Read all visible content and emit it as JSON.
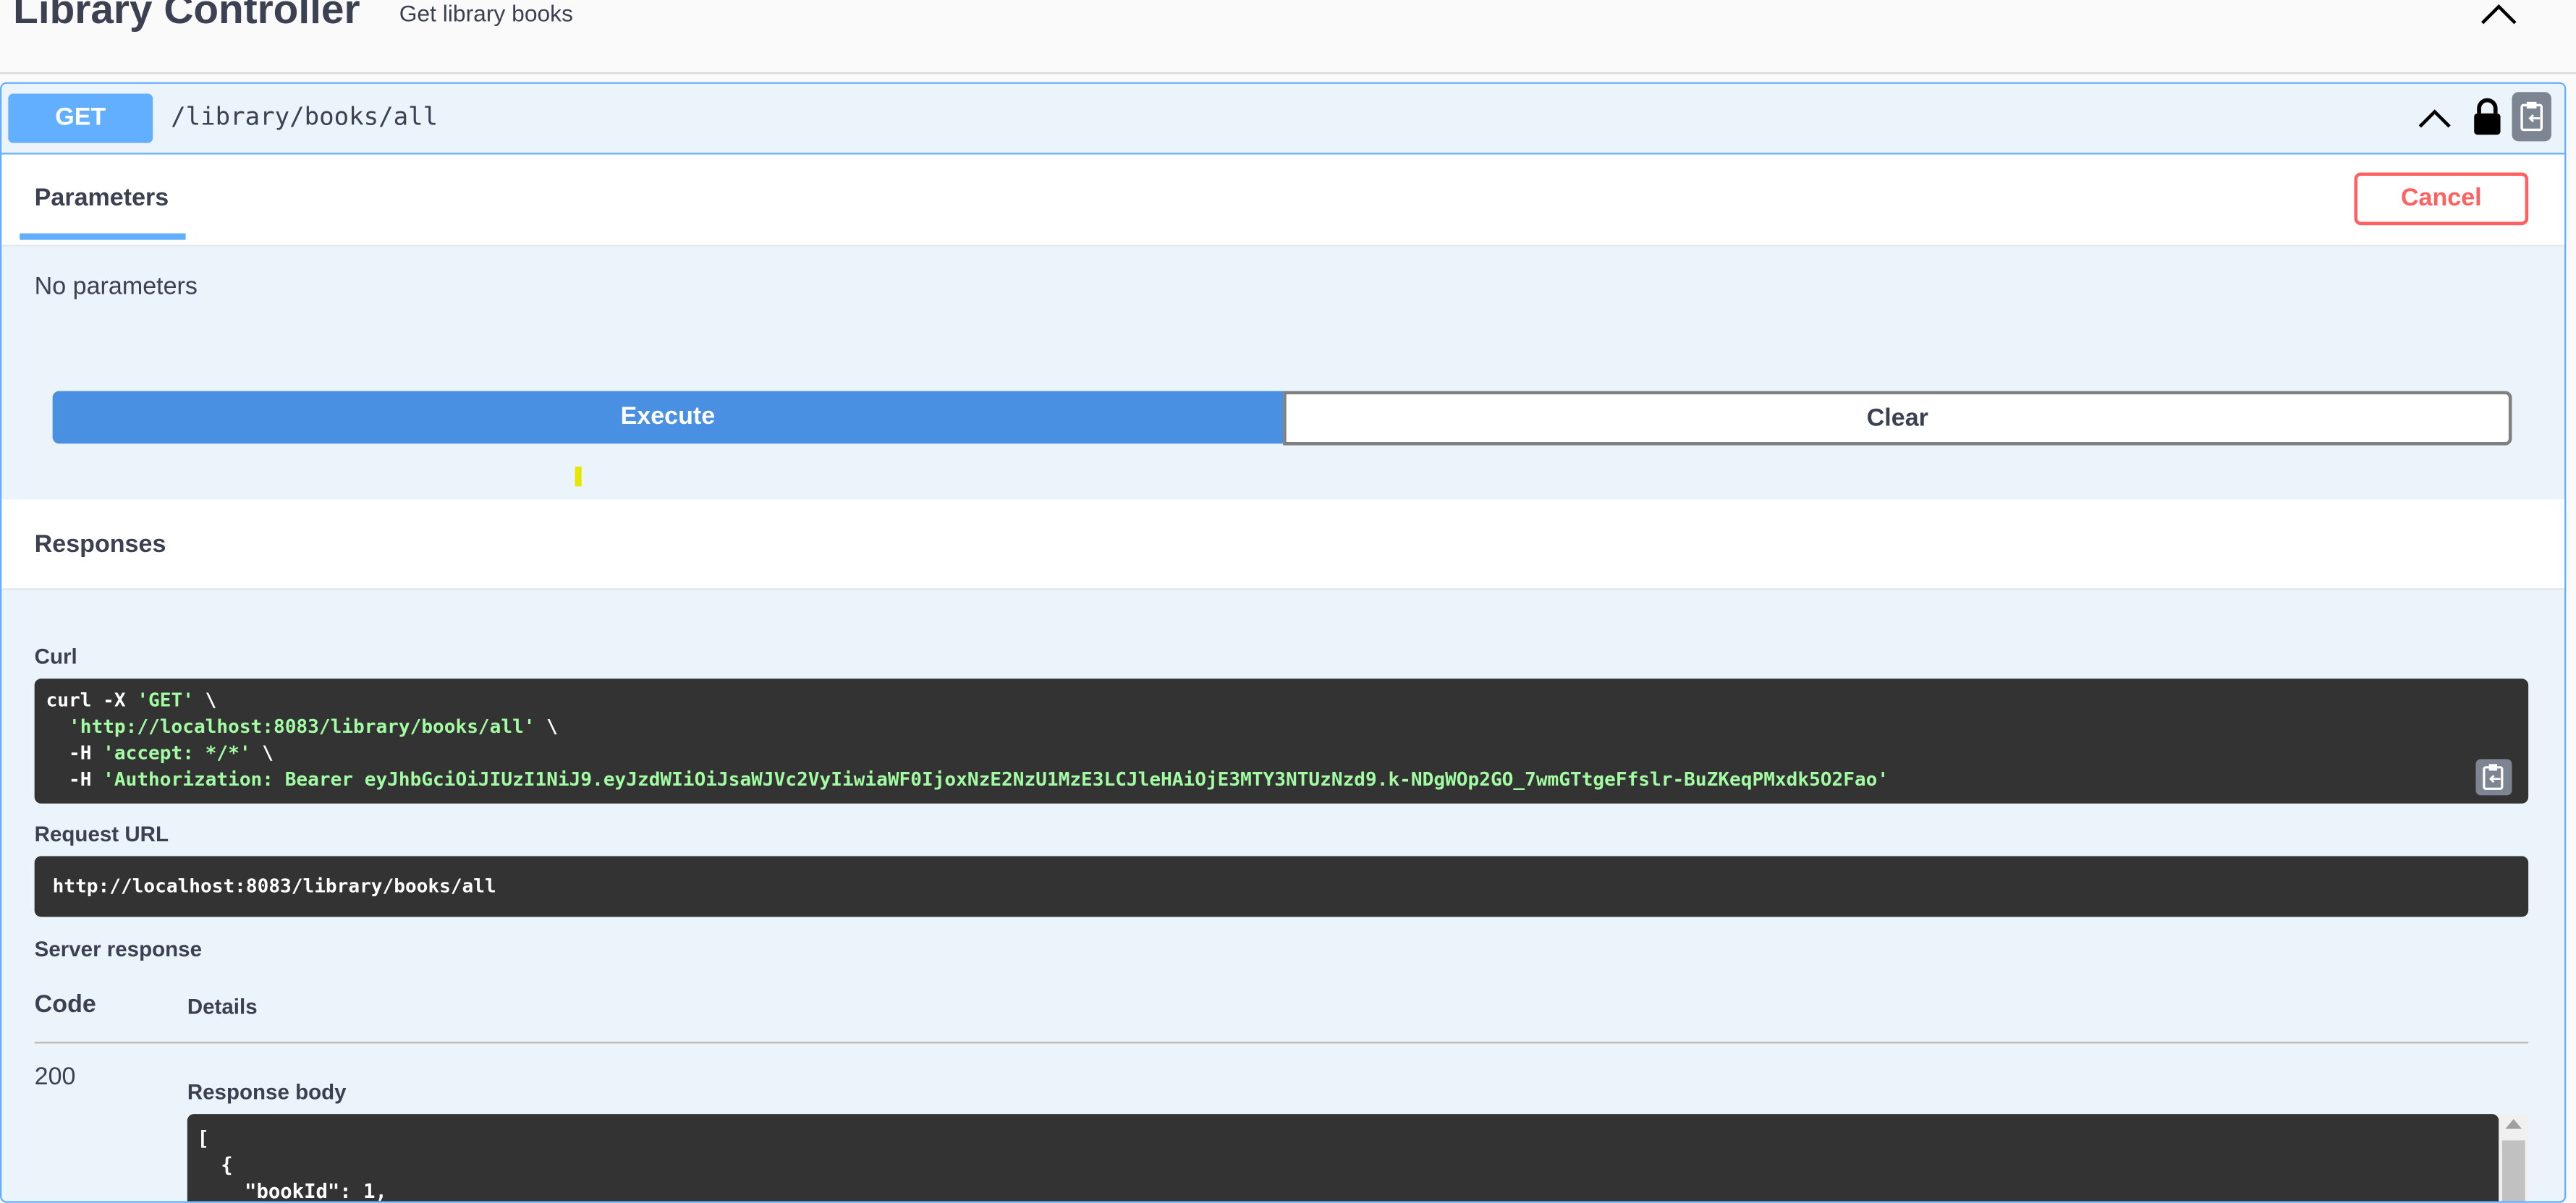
{
  "section": {
    "title": "Library Controller",
    "description": "Get library books"
  },
  "operation": {
    "method": "GET",
    "path": "/library/books/all"
  },
  "tabs": {
    "parameters": "Parameters",
    "cancel": "Cancel"
  },
  "params": {
    "empty_text": "No parameters"
  },
  "actions": {
    "execute": "Execute",
    "clear": "Clear"
  },
  "responses": {
    "title": "Responses",
    "curl_label": "Curl",
    "curl_lines": [
      {
        "pre": "curl -X ",
        "str": "'GET'",
        "post": " \\"
      },
      {
        "pre": "  ",
        "str": "'http://localhost:8083/library/books/all'",
        "post": " \\"
      },
      {
        "pre": "  -H ",
        "str": "'accept: */*'",
        "post": " \\"
      },
      {
        "pre": "  -H ",
        "str": "'Authorization: Bearer eyJhbGciOiJIUzI1NiJ9.eyJzdWIiOiJsaWJVc2VyIiwiaWF0IjoxNzE2NzU1MzE3LCJleHAiOjE3MTY3NTUzNzd9.k-NDgWOp2GO_7wmGTtgeFfslr-BuZKeqPMxdk5O2Fao'",
        "post": ""
      }
    ],
    "request_url_label": "Request URL",
    "request_url": "http://localhost:8083/library/books/all",
    "server_response_label": "Server response",
    "code_header": "Code",
    "details_header": "Details",
    "code": "200",
    "response_body_label": "Response body",
    "response_body_lines": [
      "[",
      "  {",
      "    \"bookId\": 1,"
    ]
  },
  "colors": {
    "get": "#61affe",
    "execute": "#4990e2",
    "cancel": "#ff6060"
  }
}
